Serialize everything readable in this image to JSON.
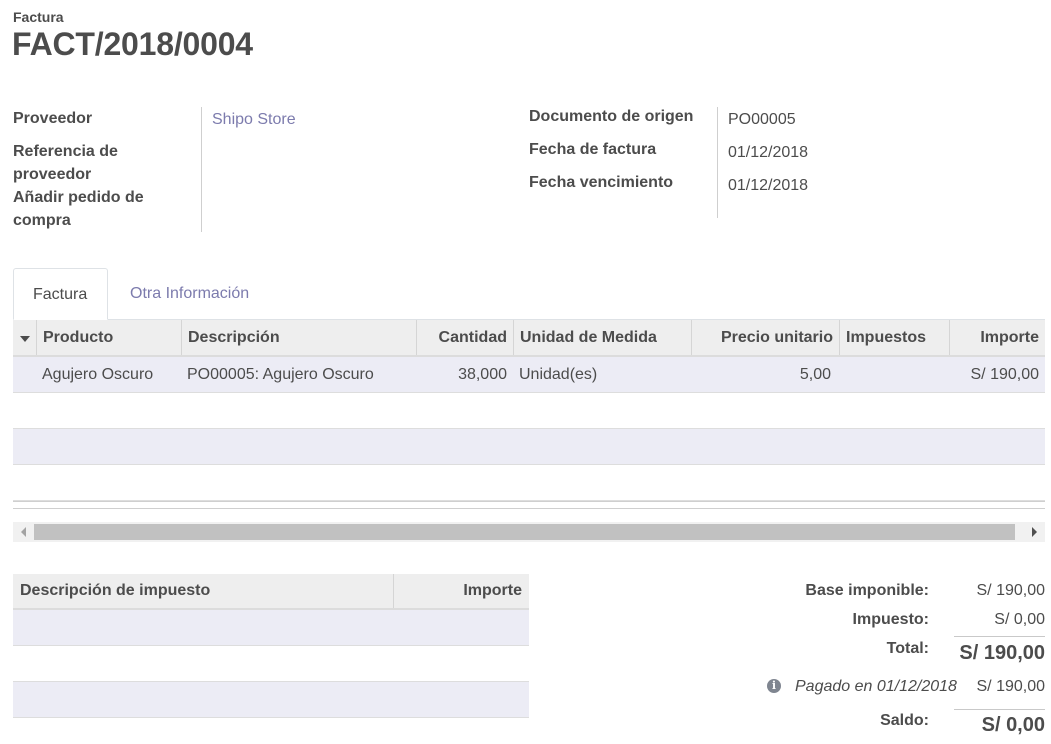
{
  "header": {
    "doc_type": "Factura",
    "doc_number": "FACT/2018/0004"
  },
  "left_group": {
    "vendor_label": "Proveedor",
    "vendor_value": "Shipo Store",
    "vendor_ref_label_1": "Referencia de",
    "vendor_ref_label_2": "proveedor",
    "add_po_label_1": "Añadir pedido de",
    "add_po_label_2": "compra"
  },
  "right_group": {
    "origin_label": "Documento de origen",
    "origin_value": "PO00005",
    "invoice_date_label": "Fecha de factura",
    "invoice_date_value": "01/12/2018",
    "due_date_label": "Fecha vencimiento",
    "due_date_value": "01/12/2018"
  },
  "tabs": [
    {
      "label": "Factura",
      "active": true
    },
    {
      "label": "Otra Información",
      "active": false
    }
  ],
  "lines_table": {
    "columns": [
      "Producto",
      "Descripción",
      "Cantidad",
      "Unidad de Medida",
      "Precio unitario",
      "Impuestos",
      "Importe"
    ],
    "rows": [
      {
        "product": "Agujero Oscuro",
        "description": "PO00005: Agujero Oscuro",
        "quantity": "38,000",
        "uom": "Unidad(es)",
        "unit_price": "5,00",
        "taxes": "",
        "amount": "S/ 190,00"
      }
    ]
  },
  "tax_table": {
    "columns": [
      "Descripción de impuesto",
      "Importe"
    ]
  },
  "totals": {
    "base_label": "Base imponible:",
    "base_value": "S/ 190,00",
    "tax_label": "Impuesto:",
    "tax_value": "S/ 0,00",
    "total_label": "Total:",
    "total_value": "S/ 190,00",
    "paid_note": "Pagado en 01/12/2018",
    "paid_value": "S/ 190,00",
    "balance_label": "Saldo:",
    "balance_value": "S/ 0,00"
  },
  "colors": {
    "link": "#7c7bad",
    "text": "#4c4c4c",
    "row_stripe": "#ececf5",
    "header_bg": "#eeeeee"
  },
  "icons": {
    "sort": "caret-down-icon",
    "info": "info-circle-icon"
  }
}
